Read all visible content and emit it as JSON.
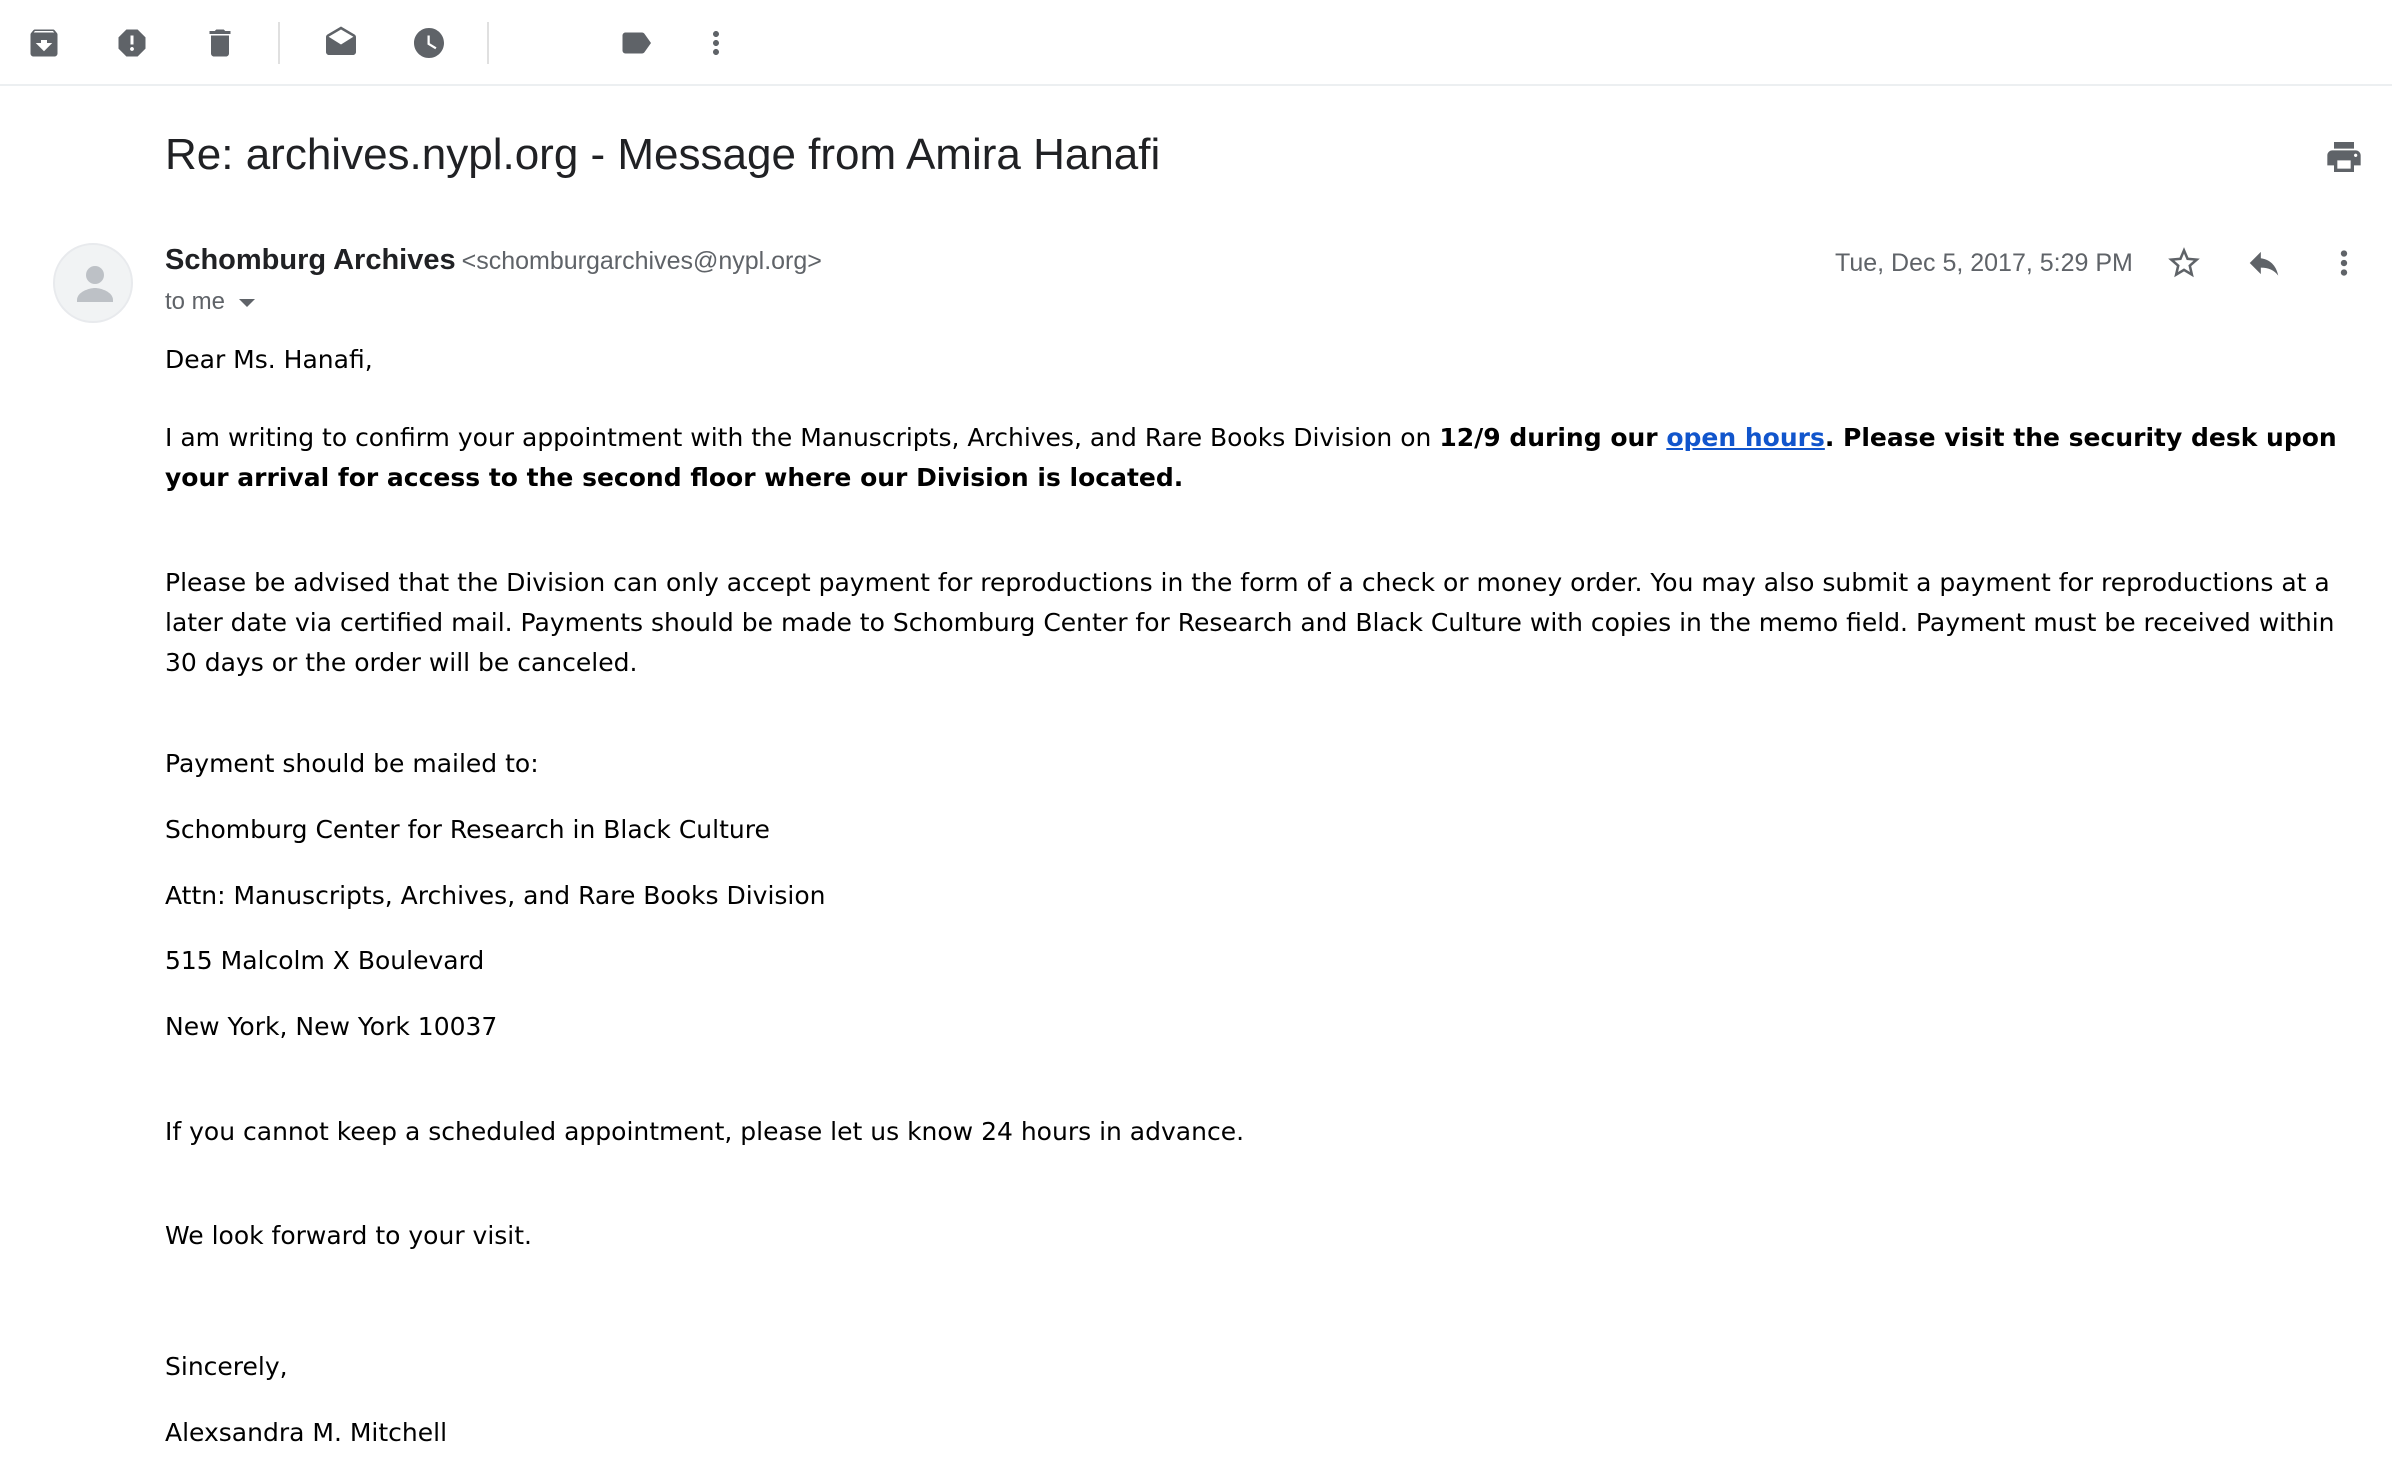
{
  "toolbar": {
    "buttons": [
      {
        "name": "archive",
        "icon": "archive-icon"
      },
      {
        "name": "report-spam",
        "icon": "report-spam-icon"
      },
      {
        "name": "delete",
        "icon": "trash-icon"
      },
      {
        "name": "mark-unread",
        "icon": "mark-unread-icon"
      },
      {
        "name": "snooze",
        "icon": "clock-icon"
      },
      {
        "name": "labels",
        "icon": "label-icon"
      },
      {
        "name": "more",
        "icon": "more-vert-icon"
      }
    ]
  },
  "email": {
    "subject": "Re: archives.nypl.org - Message from Amira Hanafi",
    "sender_name": "Schomburg Archives",
    "sender_email": "<schomburgarchives@nypl.org>",
    "to_label": "to me",
    "date": "Tue, Dec 5, 2017, 5:29 PM",
    "body": {
      "greeting": "Dear Ms. Hanafi,",
      "p1_text": "I am writing to confirm your appointment with the Manuscripts, Archives, and Rare Books Division on ",
      "p1_bold_a": "12/9 during our ",
      "p1_link": "open hours",
      "p1_bold_b": ". Please visit the security desk upon your arrival for access to the second floor where our Division is located.",
      "p2": "Please be advised that the Division can only accept payment for reproductions in the form of a check or money order. You may also submit a payment for reproductions at a later date via certified mail.  Payments should be made to Schomburg Center for Research and Black Culture with copies in the memo field. Payment must be received within 30 days or the order will be canceled.",
      "mail_intro": "Payment should be mailed to:",
      "address": [
        "Schomburg Center for Research in Black Culture",
        "Attn: Manuscripts, Archives, and Rare Books Division",
        "515 Malcolm X Boulevard",
        "New York, New York 10037"
      ],
      "p_cancel": "If you cannot keep a scheduled appointment, please let us know 24 hours in advance.",
      "p_forward": "We look forward to your visit.",
      "closing": "Sincerely,",
      "signature": "Alexsandra M. Mitchell"
    }
  },
  "colors": {
    "icon": "#5f6368",
    "link": "#1155cc",
    "divider": "#eceff1"
  }
}
